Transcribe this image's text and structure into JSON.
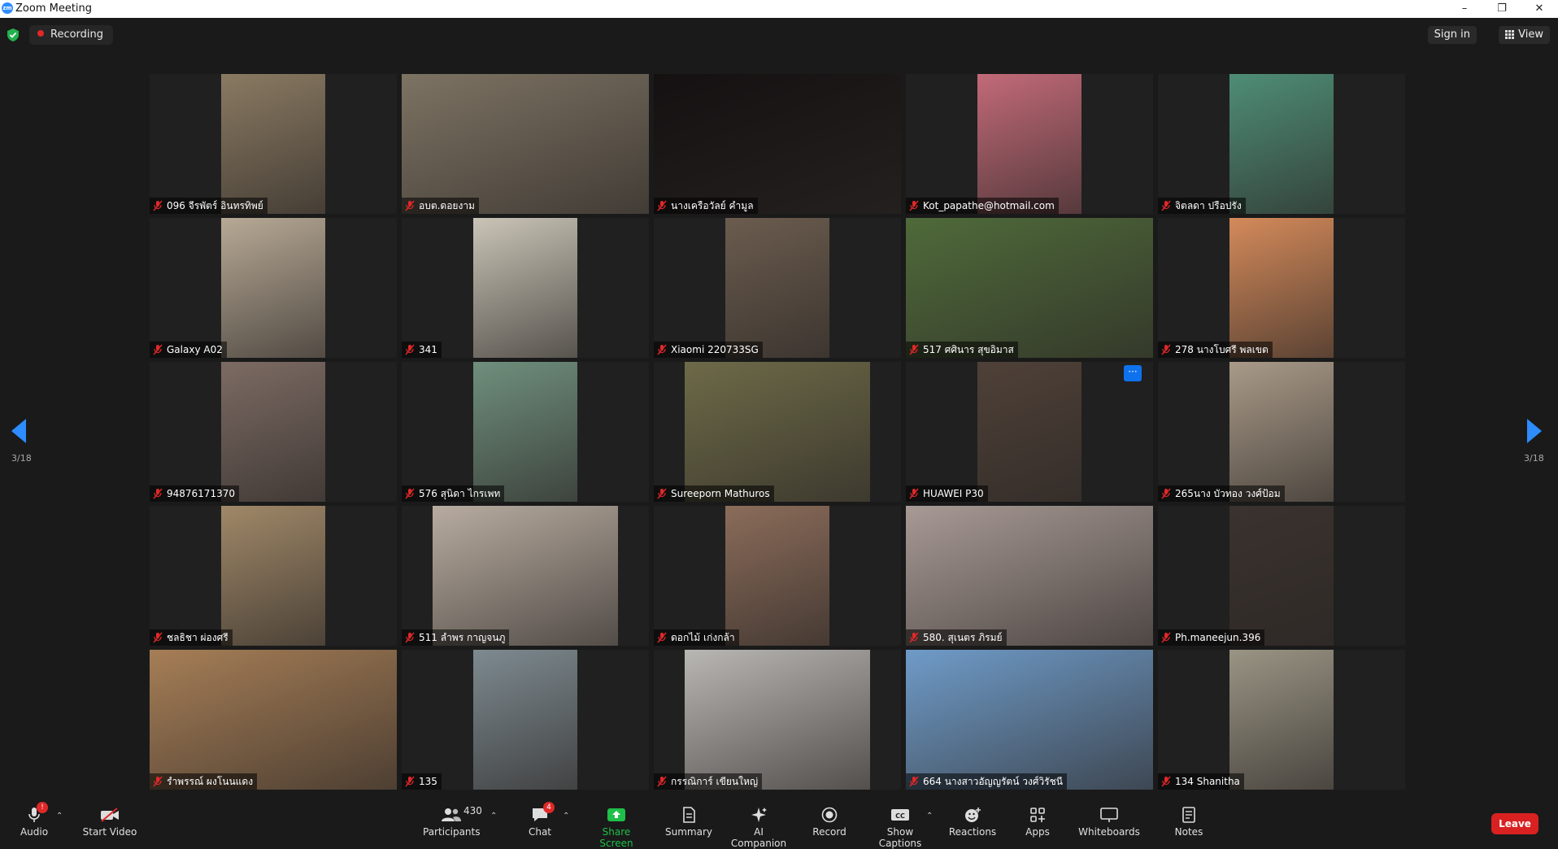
{
  "window": {
    "title": "Zoom Meeting",
    "logo_text": "zm",
    "controls": [
      "–",
      "❐",
      "✕"
    ]
  },
  "topbar": {
    "recording_label": "Recording",
    "signin_label": "Sign in",
    "view_label": "View"
  },
  "gallery": {
    "page_label_left": "3/18",
    "page_label_right": "3/18",
    "tiles": [
      {
        "name": "096 จีรพัตร์ อินทรทิพย์",
        "color": "#8a7a62"
      },
      {
        "name": "อบต.ดอยงาม",
        "color": "#7d7363"
      },
      {
        "name": "นางเครือวัลย์ คำมูล",
        "color": "#151112"
      },
      {
        "name": "Kot_papathe@hotmail.com",
        "color": "#c26a78"
      },
      {
        "name": "จิตลดา ปรือปรัง",
        "color": "#4e8d76"
      },
      {
        "name": "Galaxy A02",
        "color": "#b7a995"
      },
      {
        "name": "341",
        "color": "#c9c4b6"
      },
      {
        "name": "Xiaomi 220733SG",
        "color": "#6b5c4e"
      },
      {
        "name": "517 ศศินาร สุขอิมาส",
        "color": "#4f6a3a"
      },
      {
        "name": "278 นางโบศรี พลเขต",
        "color": "#d48a5a"
      },
      {
        "name": "94876171370",
        "color": "#7c6b63"
      },
      {
        "name": "576 สุนิดา ไกรเพท",
        "color": "#6f8f7d"
      },
      {
        "name": "Sureeporn Mathuros",
        "color": "#6d6a48"
      },
      {
        "name": "HUAWEI P30",
        "color": "#4f4138"
      },
      {
        "name": "265นาง บัวทอง วงศ์ป้อม",
        "color": "#a99a88"
      },
      {
        "name": "ชลธิชา ผ่องศรี",
        "color": "#a08868"
      },
      {
        "name": "511 ลำพร กาญจนภู",
        "color": "#b8aca0"
      },
      {
        "name": "ดอกไม้ เก่งกล้า",
        "color": "#8b6c5a"
      },
      {
        "name": "580. สุเนตร ภิรมย์",
        "color": "#a89a95"
      },
      {
        "name": "Ph.maneejun.396",
        "color": "#3a322e"
      },
      {
        "name": "รำพรรณ์ ผงโนนแดง",
        "color": "#a67e56"
      },
      {
        "name": "135",
        "color": "#7d8a90"
      },
      {
        "name": "กรรณิการ์ เขียนใหญ่",
        "color": "#b9b7b3"
      },
      {
        "name": "664 นางสาวอัญญรัตน์ วงศ์วิรัชนี",
        "color": "#6f9bc8"
      },
      {
        "name": "134 Shanitha",
        "color": "#9a9484"
      }
    ]
  },
  "toolbar": {
    "audio_label": "Audio",
    "audio_badge": "!",
    "video_label": "Start Video",
    "participants_label": "Participants",
    "participants_count": "430",
    "chat_label": "Chat",
    "chat_badge": "4",
    "share_label": "Share Screen",
    "summary_label": "Summary",
    "ai_label": "AI Companion",
    "record_label": "Record",
    "captions_label": "Show Captions",
    "captions_icon_text": "CC",
    "reactions_label": "Reactions",
    "apps_label": "Apps",
    "whiteboards_label": "Whiteboards",
    "notes_label": "Notes",
    "leave_label": "Leave"
  },
  "colors": {
    "background": "#1a1a1a",
    "tile_bg": "#202020",
    "accent_blue": "#0e72ed",
    "share_green": "#1fbf4a",
    "leave_red": "#d92121",
    "recording_red": "#e02828"
  }
}
